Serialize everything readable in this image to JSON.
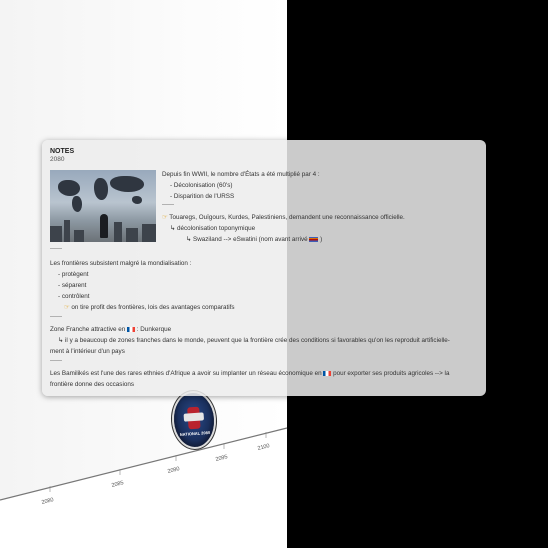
{
  "timeline": {
    "labels": [
      "2080",
      "2085",
      "2090",
      "2095",
      "2100"
    ]
  },
  "badge": {
    "text": "NATIONAL 2080",
    "icon": "badge-emblem"
  },
  "notes": {
    "title": "NOTES",
    "subtitle": "2080",
    "intro": "Depuis fin WWII, le nombre d'États a été multiplié par 4 :",
    "bullets_top": [
      "- Décolonisation (60's)",
      "- Disparition de l'URSS"
    ],
    "sep1": "——",
    "touaregs": "Touaregs, Ouïgours, Kurdes, Palestiniens, demandent une reconnaissance officielle.",
    "toponymie": "↳ décolonisation toponymique",
    "swaziland": "↳ Swaziland --> eSwatini (nom avant arrivé",
    "swaziland_end": ")",
    "sep2": "——",
    "frontieres": "Les frontières subsistent malgré la mondialisation :",
    "bullets_mid": [
      "- protègent",
      "- séparent",
      "- contrôlent"
    ],
    "profit": "on tire profit des frontières, lois des avantages comparatifs",
    "sep3": "——",
    "zone_franche": "Zone Franche attractive en",
    "zone_franche_end": ": Dunkerque",
    "zones_detail_1": "↳ il y a beaucoup de zones franches dans le monde, peuvent que la frontière crée des conditions si favorables qu'on les reproduit artificielle-",
    "zones_detail_2": "ment à l'intérieur d'un pays",
    "sep4": "——",
    "bamilikes_1": "Les Bamilikés est l'une des rares ethnies d'Afrique a avoir su implanter un réseau économique en",
    "bamilikes_1_end": "pour exporter ses produits agricoles --> la",
    "bamilikes_2": "frontière donne des occasions",
    "icons": [
      "pointing-hand-icon",
      "france-flag-icon",
      "eswatini-flag-icon"
    ]
  }
}
